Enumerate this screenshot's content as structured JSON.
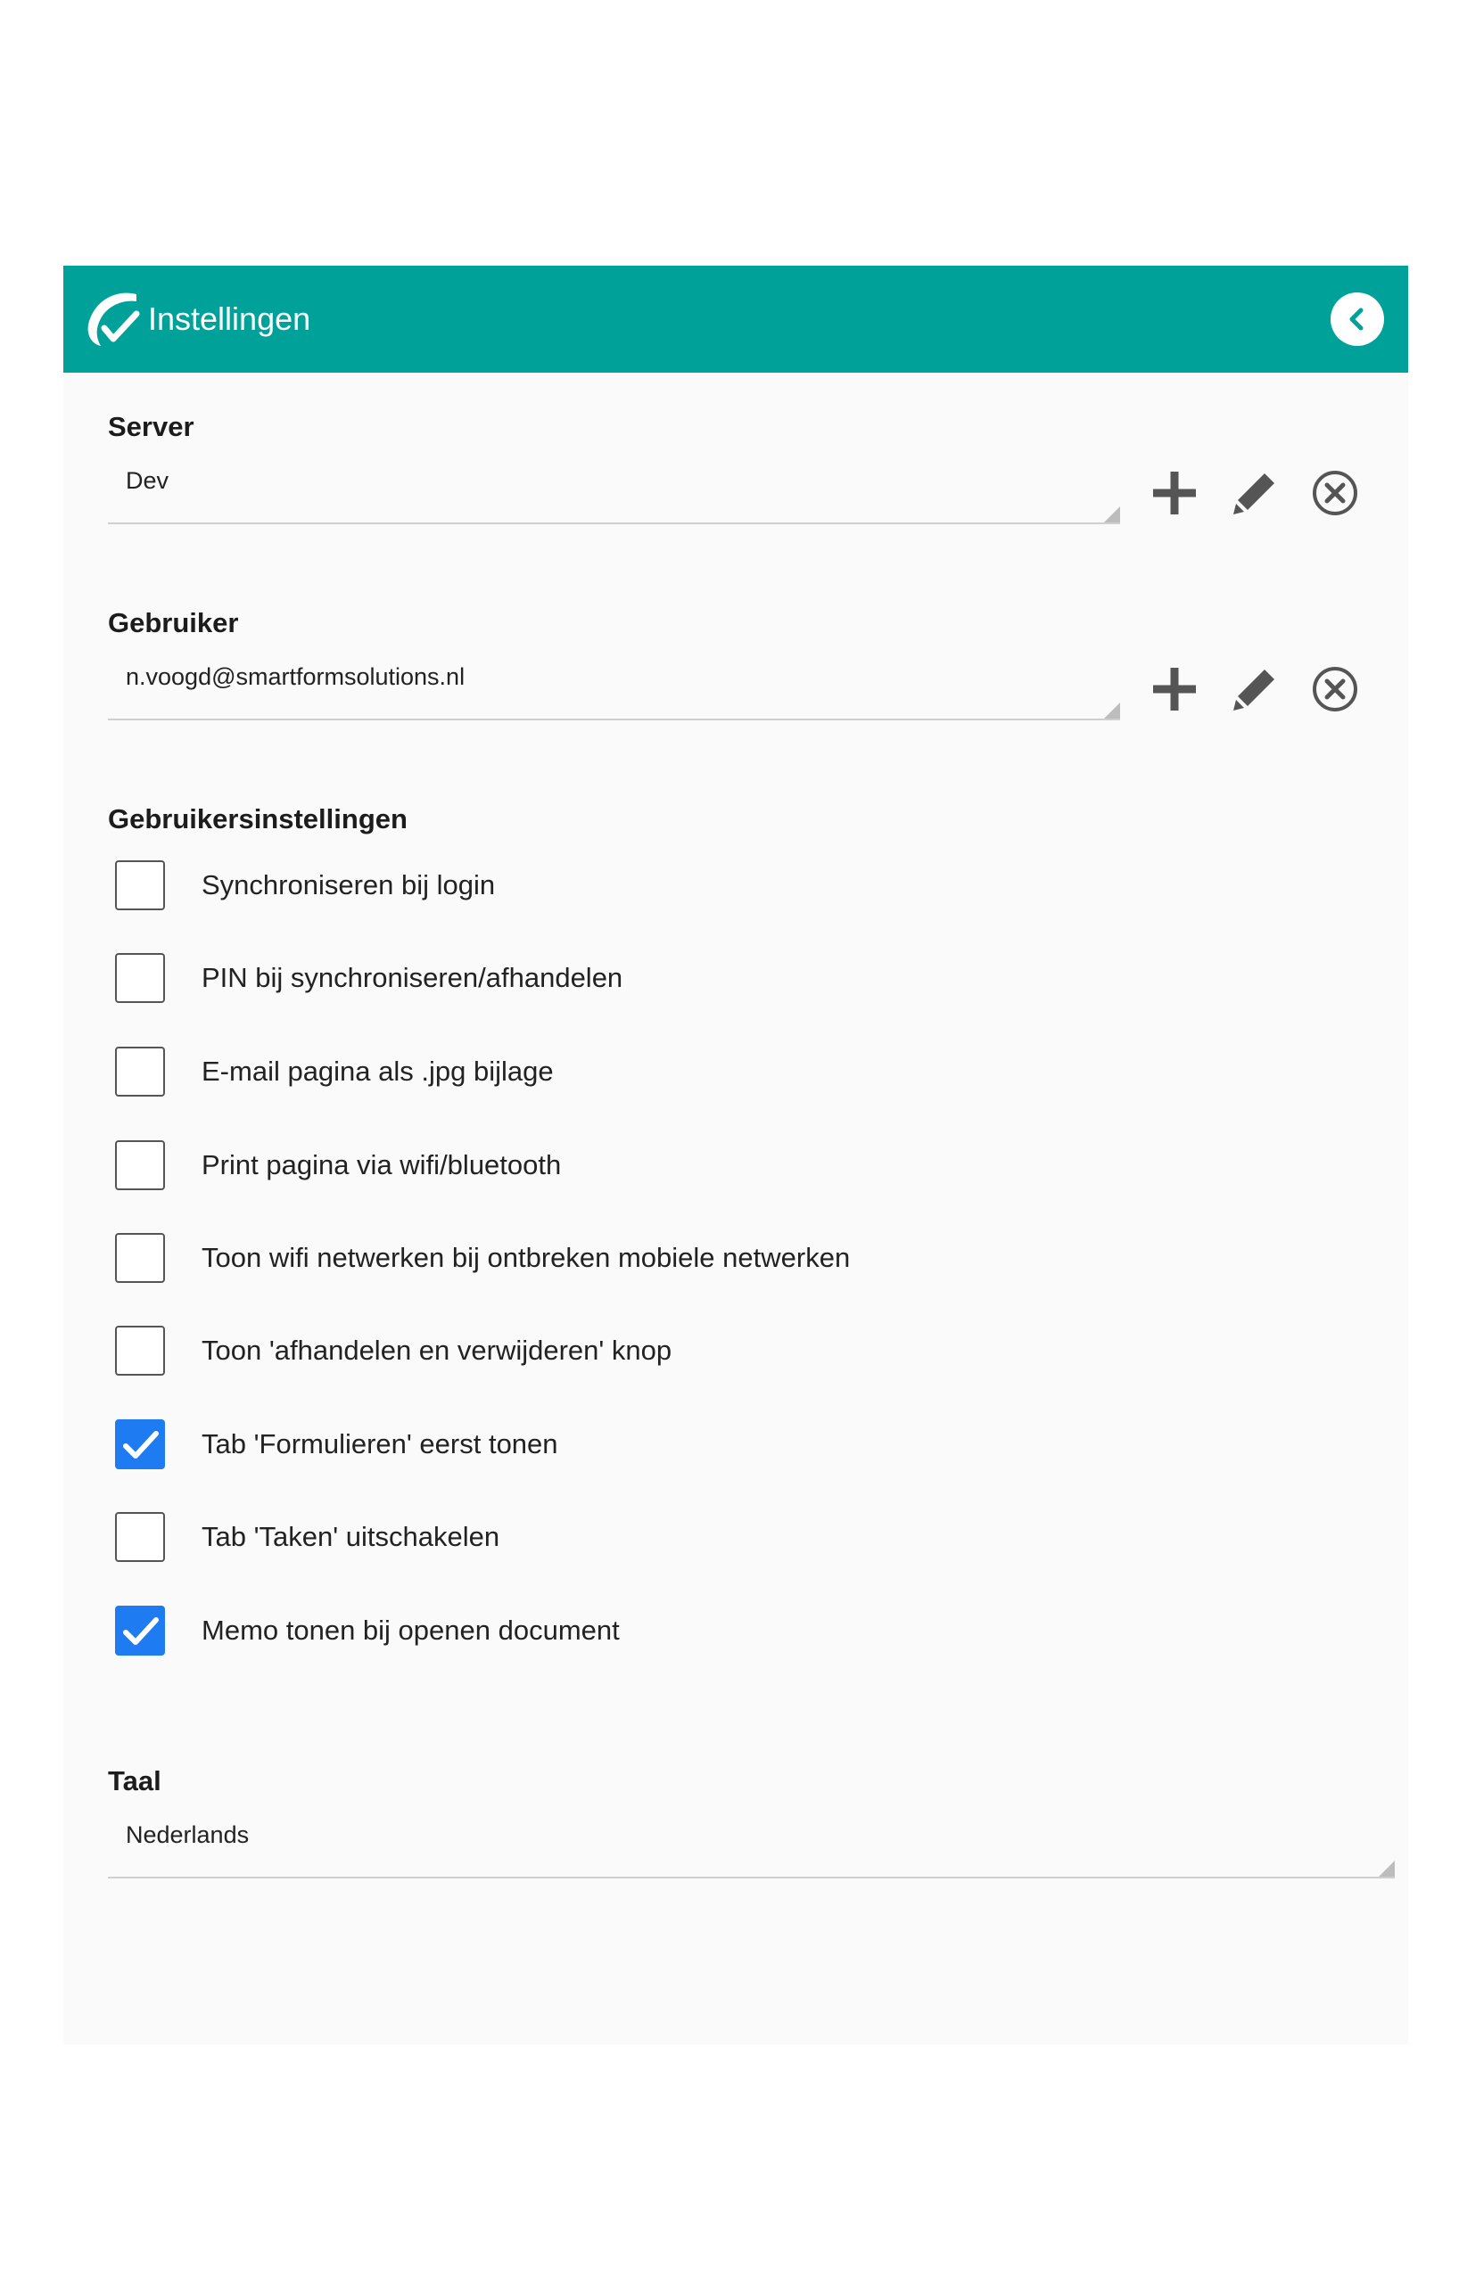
{
  "header": {
    "title": "Instellingen",
    "back_icon": "chevron-left-icon",
    "color": "#00a199"
  },
  "server": {
    "label": "Server",
    "value": "Dev"
  },
  "user": {
    "label": "Gebruiker",
    "value": "n.voogd@smartformsolutions.nl"
  },
  "user_settings": {
    "label": "Gebruikersinstellingen",
    "options": [
      {
        "label": "Synchroniseren bij login",
        "checked": false
      },
      {
        "label": "PIN bij synchroniseren/afhandelen",
        "checked": false
      },
      {
        "label": "E-mail pagina als .jpg bijlage",
        "checked": false
      },
      {
        "label": "Print pagina via wifi/bluetooth",
        "checked": false
      },
      {
        "label": "Toon wifi netwerken bij ontbreken mobiele netwerken",
        "checked": false
      },
      {
        "label": "Toon 'afhandelen en verwijderen' knop",
        "checked": false
      },
      {
        "label": "Tab 'Formulieren' eerst tonen",
        "checked": true
      },
      {
        "label": "Tab 'Taken' uitschakelen",
        "checked": false
      },
      {
        "label": "Memo tonen bij openen document",
        "checked": true
      }
    ]
  },
  "language": {
    "label": "Taal",
    "value": "Nederlands"
  },
  "colors": {
    "accent": "#00a199",
    "checkbox_checked": "#1e7bf2",
    "icon": "#555555"
  },
  "icons": {
    "add": "plus-icon",
    "edit": "pencil-icon",
    "delete": "close-circle-icon"
  }
}
